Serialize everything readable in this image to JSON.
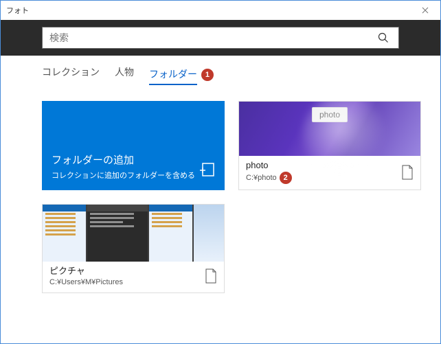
{
  "window": {
    "title": "フォト"
  },
  "search": {
    "placeholder": "検索"
  },
  "tabs": {
    "collection": "コレクション",
    "people": "人物",
    "folders": "フォルダー"
  },
  "badges": {
    "tab_folders": "1",
    "photo_tile": "2"
  },
  "addTile": {
    "title": "フォルダーの追加",
    "subtitle": "コレクションに追加のフォルダーを含める"
  },
  "tiles": {
    "photo": {
      "label_overlay": "photo",
      "title": "photo",
      "path": "C:¥photo"
    },
    "pictures": {
      "title": "ピクチャ",
      "path": "C:¥Users¥M¥Pictures"
    }
  }
}
